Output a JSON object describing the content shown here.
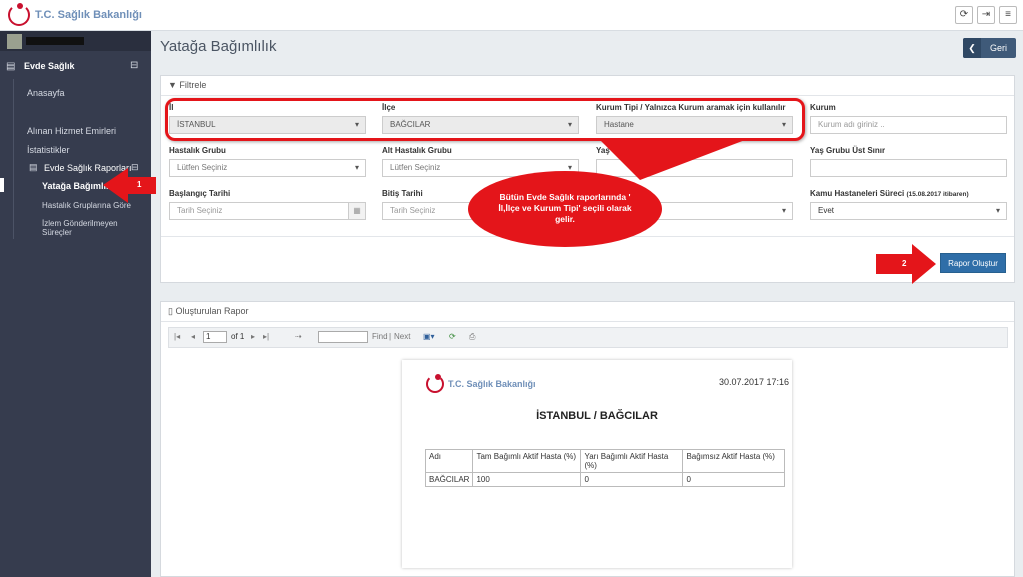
{
  "header": {
    "logo_text": "T.C. Sağlık Bakanlığı",
    "buttons": [
      {
        "name": "refresh-button",
        "icon": "refresh-icon",
        "glyph": "⟳"
      },
      {
        "name": "logout-button",
        "icon": "logout-icon",
        "glyph": "⇥"
      },
      {
        "name": "menu-button",
        "icon": "hamburger-icon",
        "glyph": "≡"
      }
    ]
  },
  "sidebar": {
    "section_title": "Evde Sağlık",
    "items": [
      {
        "label": "Anasayfa"
      },
      {
        "label": "Alınan Hizmet Emirleri"
      },
      {
        "label": "İstatistikler"
      },
      {
        "label": "Evde Sağlık Raporları"
      },
      {
        "label": "Yatağa Bağımlılık"
      },
      {
        "label": "Hastalık Gruplarına Göre"
      },
      {
        "label": "İzlem Gönderilmeyen Süreçler"
      }
    ]
  },
  "page": {
    "title": "Yatağa Bağımlılık",
    "back_label": "Geri"
  },
  "filter": {
    "title": "Filtrele",
    "il": {
      "label": "İl",
      "value": "İSTANBUL"
    },
    "ilce": {
      "label": "İlçe",
      "value": "BAĞCILAR"
    },
    "kurum_tipi": {
      "label": "Kurum Tipi / Yalnızca Kurum aramak için kullanılır",
      "value": "Hastane"
    },
    "kurum": {
      "label": "Kurum",
      "placeholder": "Kurum adı giriniz .."
    },
    "hastalik_grubu": {
      "label": "Hastalık Grubu",
      "value": "Lütfen Seçiniz"
    },
    "alt_hastalik_grubu": {
      "label": "Alt Hastalık Grubu",
      "value": "Lütfen Seçiniz"
    },
    "yas_alt": {
      "label": "Yaş Grubu Alt Sınır"
    },
    "yas_ust": {
      "label": "Yaş Grubu Üst Sınır"
    },
    "baslangic": {
      "label": "Başlangıç Tarihi",
      "placeholder": "Tarih Seçiniz"
    },
    "bitis": {
      "label": "Bitiş Tarihi",
      "placeholder": "Tarih Seçiniz"
    },
    "kamu": {
      "label": "Kamu Hastaneleri Süreci",
      "label_suffix": "(15.08.2017 itibaren)",
      "value": "Evet"
    },
    "submit_label": "Rapor Oluştur"
  },
  "annotations": {
    "callout_text": "Bütün Evde Sağlık raporlarında ' İl,İlçe ve Kurum Tipi' seçili olarak gelir.",
    "step1": "1",
    "step2": "2"
  },
  "report": {
    "panel_title": "Oluşturulan Rapor",
    "page_input": "1",
    "page_of": "of 1",
    "find_label": "Find",
    "next_label": "Next",
    "doc_logo": "T.C. Sağlık Bakanlığı",
    "datetime": "30.07.2017 17:16",
    "heading": "İSTANBUL / BAĞCILAR",
    "table": {
      "headers": [
        "Adı",
        "Tam Bağımlı Aktif Hasta (%)",
        "Yarı Bağımlı Aktif Hasta (%)",
        "Bağımsız Aktif Hasta (%)"
      ],
      "rows": [
        [
          "BAĞCILAR",
          "100",
          "0",
          "0"
        ]
      ]
    }
  },
  "colors": {
    "accent": "#e4151a",
    "sidebar": "#363c4e",
    "primary": "#2f6ea8"
  }
}
